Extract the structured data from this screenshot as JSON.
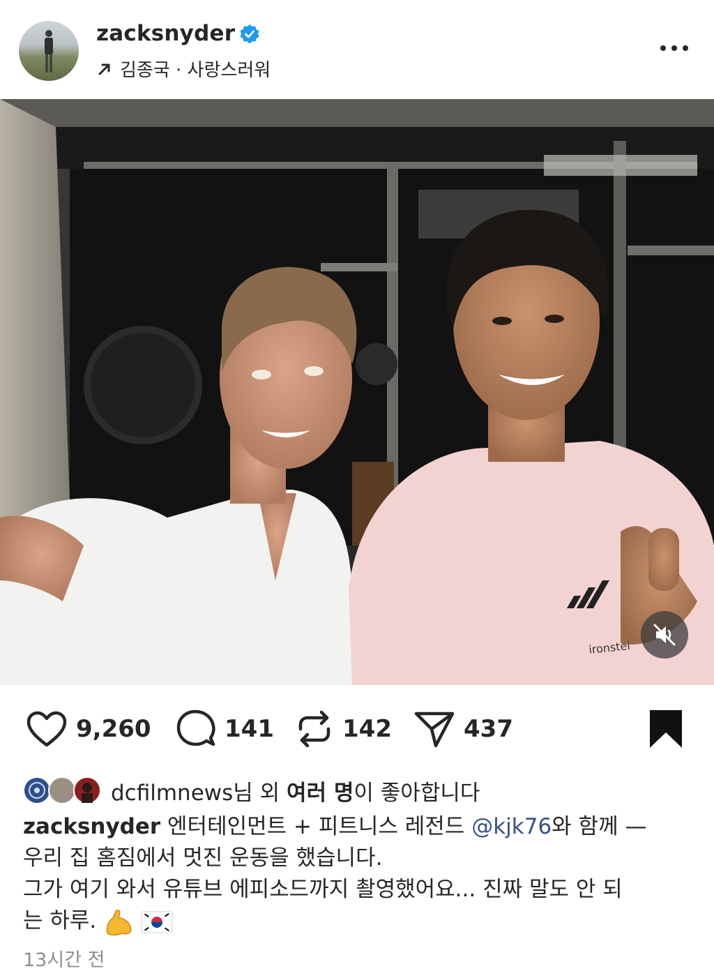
{
  "post": {
    "username": "zacksnyder",
    "audio_label": "김종국 · 사랑스러워",
    "photo_alt": "selfie",
    "actions": {
      "likes": "9,260",
      "comments": "141",
      "reposts": "142",
      "shares": "437"
    },
    "liked_by": {
      "name": "dcfilmnews",
      "mid1": "님 외 ",
      "bold": "여러 명",
      "tail": "이 좋아합니다"
    },
    "caption": {
      "username": "zacksnyder",
      "line1_a": " 엔터테인먼트 + 피트니스 레전드 ",
      "mention": "@kjk76",
      "line1_b": "와 함께 —",
      "line2": "우리 집 홈짐에서 멋진 운동을 했습니다.",
      "line3": "그가 여기 와서 유튜브 에피소드까지 촬영했어요... 진짜 말도 안 되",
      "line4": "는 하루."
    },
    "timestamp": "13시간 전"
  },
  "icons": [
    "verified-badge-icon",
    "arrow-up-right-icon",
    "more-options-icon",
    "heart-icon",
    "comment-icon",
    "repost-icon",
    "share-icon",
    "bookmark-icon",
    "mute-icon",
    "flexed-bicep-emoji",
    "korea-flag-emoji"
  ],
  "colors": {
    "verified": "#1d9bf0",
    "mention": "#38508c",
    "muted_text": "#8e8e8e"
  }
}
